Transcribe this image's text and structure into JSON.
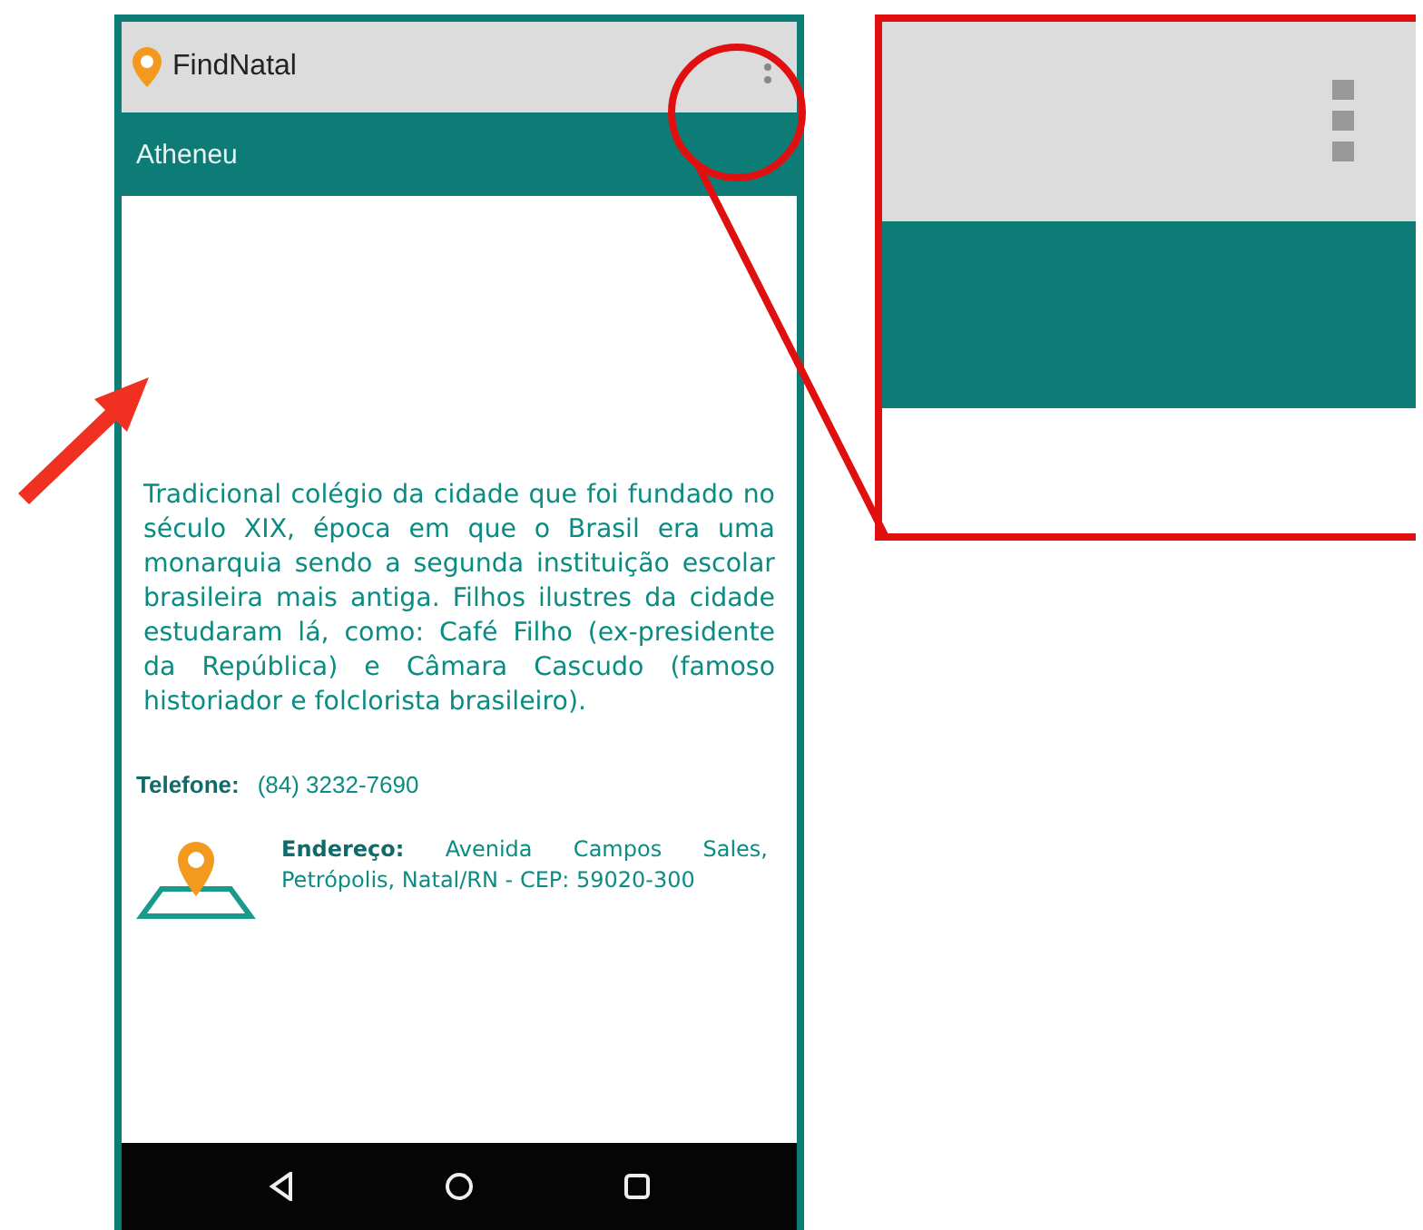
{
  "app_bar": {
    "title": "FindNatal"
  },
  "header": {
    "title": "Atheneu"
  },
  "description": "Tradicional colégio da cidade que foi fundado no século XIX, época em que o Brasil era uma monarquia sendo a segunda instituição escolar brasileira mais antiga. Filhos ilustres da cidade estudaram lá, como: Café Filho (ex-presidente da República) e Câmara Cascudo (famoso historiador e folclorista brasileiro).",
  "phone": {
    "label": "Telefone:",
    "value": "(84) 3232-7690"
  },
  "address": {
    "text": "**Endereço:** Avenida Campos Sales, Petrópolis, Natal/RN - CEP: 59020-300"
  }
}
